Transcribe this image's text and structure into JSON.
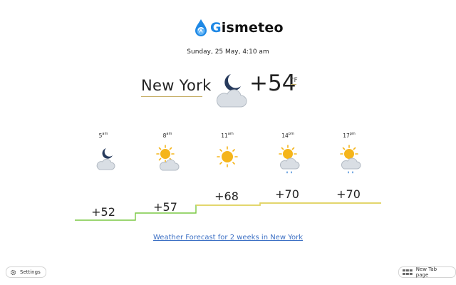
{
  "app": {
    "brand_first": "G",
    "brand_rest": "ismeteo",
    "date": "Sunday, 25 May, 4:10 am"
  },
  "current": {
    "city": "New York",
    "temp": "+54",
    "unit": "°F",
    "icon": "moon-cloud-icon"
  },
  "forecast": [
    {
      "hour": "5",
      "ampm": "am",
      "temp": "+52",
      "icon": "moon-cloud-icon"
    },
    {
      "hour": "8",
      "ampm": "am",
      "temp": "+57",
      "icon": "sun-cloud-icon"
    },
    {
      "hour": "11",
      "ampm": "am",
      "temp": "+68",
      "icon": "sun-icon"
    },
    {
      "hour": "14",
      "ampm": "pm",
      "temp": "+70",
      "icon": "sun-cloud-rain-icon"
    },
    {
      "hour": "17",
      "ampm": "pm",
      "temp": "+70",
      "icon": "sun-cloud-rain-icon"
    }
  ],
  "colors": {
    "brand_blue": "#1e88e5",
    "link": "#3b6fc4",
    "sun": "#f5b51b",
    "cloud": "#d8dde3",
    "step_green": "#7ac943",
    "step_yellow": "#f0d25c"
  },
  "link_text": "Weather Forecast for 2 weeks in New York",
  "buttons": {
    "settings": "Settings",
    "new_tab": "New Tab page"
  }
}
